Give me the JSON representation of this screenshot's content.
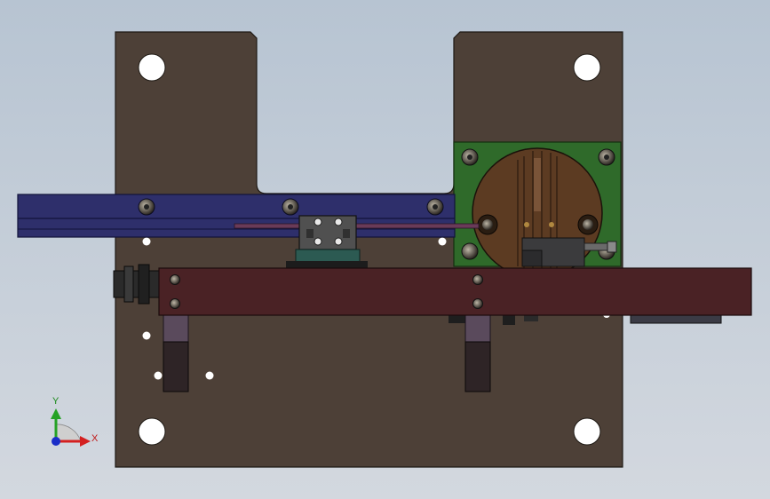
{
  "viewport": {
    "background_top": "#b9c6d3",
    "background_bottom": "#d4d9e0"
  },
  "colors": {
    "base_plate": "#4d4037",
    "base_edge": "#1e1914",
    "rail": "#2e2f6b",
    "rail_edge": "#12133a",
    "green_plate": "#2f6a2a",
    "disc": "#5c3b22",
    "slider_bar": "#4a2225",
    "carriage": "#505050",
    "carriage_base": "#2c5a52",
    "hole": "#ffffff",
    "x_axis": "#d42020",
    "y_axis": "#25a225",
    "z_axis": "#1a2ec8"
  },
  "triad": {
    "x_label": "X",
    "y_label": "Y",
    "icons": [
      "x-axis-arrow-icon",
      "y-axis-arrow-icon",
      "z-axis-dot-icon"
    ]
  }
}
